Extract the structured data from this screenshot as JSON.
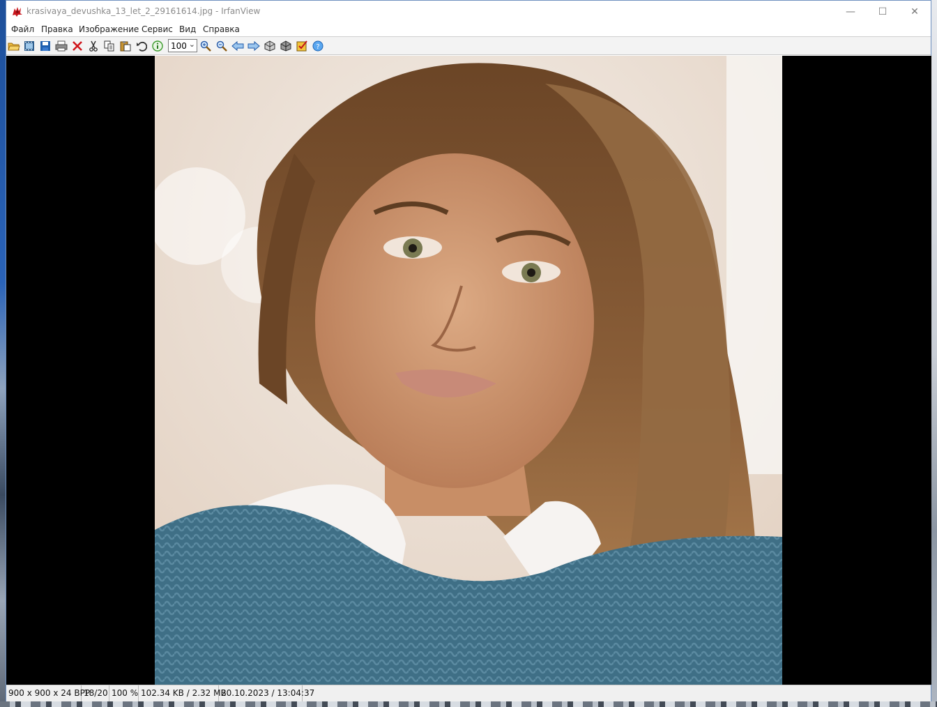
{
  "window": {
    "title": "krasivaya_devushka_13_let_2_29161614.jpg - IrfanView",
    "app_icon": "irfanview-red-cat-icon",
    "controls": {
      "minimize": "—",
      "maximize": "☐",
      "close": "✕"
    }
  },
  "menu": {
    "items": [
      "Файл",
      "Правка",
      "Изображение",
      "Сервис",
      "Вид",
      "Справка"
    ]
  },
  "toolbar": {
    "icons": [
      "open-folder-icon",
      "slideshow-icon",
      "save-icon",
      "print-icon",
      "delete-icon",
      "cut-icon",
      "copy-icon",
      "paste-icon",
      "undo-icon",
      "info-icon",
      "zoom-combo",
      "zoom-in-icon",
      "zoom-out-icon",
      "previous-icon",
      "next-icon",
      "previous-dir-icon",
      "next-dir-icon",
      "thumbnails-icon",
      "help-icon"
    ],
    "zoom_value": "100"
  },
  "image": {
    "description_name": "portrait-photo",
    "colors": {
      "hair": "#7a5232",
      "sweater": "#3f6f86",
      "collar": "#f6f3f1",
      "skin": "#d9a47f",
      "background": "#efe6de"
    }
  },
  "status": {
    "dimensions": "900 x 900 x 24 BPP",
    "index": "18/20",
    "zoom": "100 %",
    "size": "102.34 KB / 2.32 MB",
    "datetime": "20.10.2023 / 13:04:37"
  }
}
